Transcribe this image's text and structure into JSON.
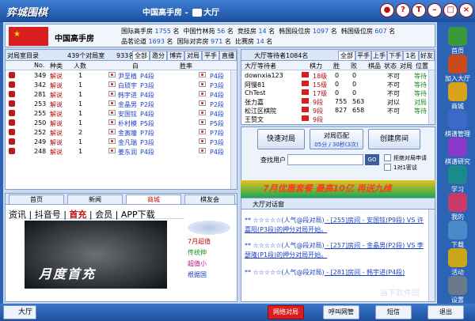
{
  "app": {
    "logo": "弈城围棋",
    "title": "中国高手房",
    "title_sep": " - ",
    "hall": "大厅"
  },
  "room": {
    "name": "中国高手房",
    "list": [
      {
        "name": "国际高手房",
        "count": "1755",
        "unit": "名"
      },
      {
        "name": "中国竹林苑",
        "count": "56",
        "unit": "名"
      },
      {
        "name": "竞技房",
        "count": "14",
        "unit": "名"
      },
      {
        "name": "韩国段位房",
        "count": "1097",
        "unit": "名"
      },
      {
        "name": "韩国级位房",
        "count": "607",
        "unit": "名"
      },
      {
        "name": "品茗论道",
        "count": "1693",
        "unit": "名"
      },
      {
        "name": "国际对弈房",
        "count": "971",
        "unit": "名"
      },
      {
        "name": "比赛房",
        "count": "14",
        "unit": "名"
      }
    ]
  },
  "left": {
    "title": "对局室目录",
    "subtitle": "439个对局室",
    "count": "933名",
    "tabs": [
      "全部",
      "邀分",
      "博弈",
      "对局",
      "平手",
      "直播"
    ],
    "headers": [
      "No.",
      "种类",
      "人数",
      "白",
      "胜率"
    ],
    "rows": [
      {
        "no": "349",
        "type": "解说",
        "num": "1",
        "white": "尹至植",
        "rank": "P4段"
      },
      {
        "no": "342",
        "type": "解说",
        "num": "1",
        "white": "白琐宇",
        "rank": "P3段"
      },
      {
        "no": "281",
        "type": "解说",
        "num": "1",
        "white": "韩宇进",
        "rank": "P4段"
      },
      {
        "no": "253",
        "type": "解说",
        "num": "1",
        "white": "金晶男",
        "rank": "P2段"
      },
      {
        "no": "255",
        "type": "解说",
        "num": "1",
        "white": "安国铉",
        "rank": "P4段"
      },
      {
        "no": "250",
        "type": "解说",
        "num": "1",
        "white": "朴村模",
        "rank": "P5段"
      },
      {
        "no": "252",
        "type": "解说",
        "num": "2",
        "white": "金寅瞳",
        "rank": "P7段"
      },
      {
        "no": "249",
        "type": "解说",
        "num": "1",
        "white": "金凡瑞",
        "rank": "P3段"
      },
      {
        "no": "248",
        "type": "解说",
        "num": "1",
        "white": "姜东润",
        "rank": "P4段"
      }
    ]
  },
  "right": {
    "title": "大厅等待者1084名",
    "tabs": [
      "全部",
      "平手",
      "上手",
      "下手",
      "1名",
      "好友"
    ],
    "headers": [
      "大厅等待者",
      "棋力",
      "胜",
      "败",
      "棋品",
      "状态",
      "对局",
      "位置"
    ],
    "rows": [
      {
        "name": "downxia123",
        "rank": "18级",
        "win": "0",
        "lose": "0",
        "status": "不可",
        "pos": "等待"
      },
      {
        "name": "阿慢81",
        "rank": "15级",
        "win": "0",
        "lose": "0",
        "status": "不可",
        "pos": "等待"
      },
      {
        "name": "ChTest",
        "rank": "17级",
        "win": "0",
        "lose": "0",
        "status": "不可",
        "pos": "等待"
      },
      {
        "name": "张力嘉",
        "rank": "9段",
        "win": "755",
        "lose": "563",
        "status": "对以",
        "pos": "对局"
      },
      {
        "name": "松江区棋院",
        "rank": "9段",
        "win": "827",
        "lose": "658",
        "status": "不可",
        "pos": "等待"
      },
      {
        "name": "王赞文",
        "rank": "9段",
        "win": "",
        "lose": "",
        "status": "",
        "pos": ""
      }
    ]
  },
  "ctrl": {
    "quick": "快速对局",
    "match": "对局匹配",
    "match_time": "05分 / 30秒(3次)",
    "create": "创建房间",
    "find_label": "查找用户",
    "go": "GO",
    "opt1": "拒绝对局申请",
    "opt2": "1对1密谈"
  },
  "news": {
    "tabs": [
      "首页",
      "新闻",
      "商城",
      "棋友会"
    ],
    "nav": [
      "资讯",
      "抖音号",
      "首充",
      "会员",
      "APP下载"
    ],
    "banner_text": "月度首充",
    "ad_lines": [
      "7月超值",
      "传统伸",
      "超值小",
      "根据国"
    ]
  },
  "chat": {
    "title": "大厅对话窗",
    "promo": "7月优惠套餐 最高10亿 再送九维",
    "lines": [
      {
        "stars": "** ☆☆☆☆☆(人气@段对局)",
        "desc": " - [255]房间 - 安国铉(P9段) VS 许嘉阳(P3段)的押分对局开始。"
      },
      {
        "stars": "** ☆☆☆☆☆(人气@段对局)",
        "desc": " - [257]房间 - 金晶男(P2段) VS 李瑟隆(P1段)的押分对局开始。"
      },
      {
        "stars": "** ☆☆☆☆☆(人气@段对局)",
        "desc": " - [281]房间 - 韩宇进(P4段)"
      }
    ]
  },
  "side": [
    "首页",
    "加入大厅",
    "商城",
    "棋谱管理",
    "棋谱研究",
    "学习",
    "我的",
    "下载",
    "活动",
    "设置"
  ],
  "bottom": {
    "lobby": "大厅",
    "b1": "网络对局",
    "b2": "呼叫网管",
    "b3": "短信",
    "b4": "退出"
  },
  "watermark": "当下软件园"
}
